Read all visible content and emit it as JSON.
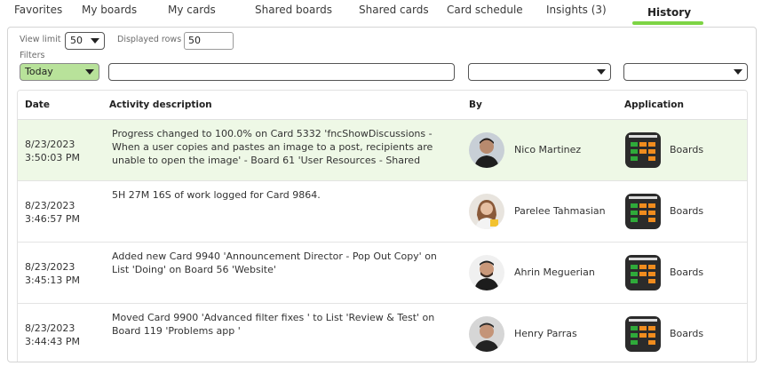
{
  "tabs": [
    {
      "label": "Favorites"
    },
    {
      "label": "My boards"
    },
    {
      "label": "My cards"
    },
    {
      "label": "Shared boards"
    },
    {
      "label": "Shared cards"
    },
    {
      "label": "Card schedule"
    },
    {
      "label": "Insights (3)"
    },
    {
      "label": "History",
      "active": true
    }
  ],
  "controls": {
    "view_limit_label": "View limit",
    "view_limit_value": "50",
    "displayed_rows_label": "Displayed rows",
    "displayed_rows_value": "50",
    "filters_label": "Filters",
    "date_filter_value": "Today",
    "search_value": "",
    "user_filter_value": "",
    "application_filter_value": ""
  },
  "table": {
    "columns": [
      "Date",
      "Activity description",
      "By",
      "Application"
    ],
    "rows": [
      {
        "date": "8/23/2023",
        "time": "3:50:03 PM",
        "description": "Progress changed to 100.0% on Card 5332 'fncShowDiscussions - When a user copies and pastes an image to a post, recipients are unable to open the image' - Board 61 'User Resources - Shared",
        "user": "Nico Martinez",
        "application": "Boards",
        "highlight": true
      },
      {
        "date": "8/23/2023",
        "time": "3:46:57 PM",
        "description": "5H 27M 16S of work logged for Card 9864.",
        "user": "Parelee Tahmasian",
        "application": "Boards"
      },
      {
        "date": "8/23/2023",
        "time": "3:45:13 PM",
        "description": "Added new Card 9940 'Announcement Director - Pop Out Copy' on List 'Doing' on Board 56 'Website'",
        "user": "Ahrin Meguerian",
        "application": "Boards"
      },
      {
        "date": "8/23/2023",
        "time": "3:44:43 PM",
        "description": "Moved Card 9900 'Advanced filter fixes ' to List 'Review & Test' on Board 119 'Problems app  '",
        "user": "Henry Parras",
        "application": "Boards"
      }
    ]
  },
  "colors": {
    "active_tab_underline": "#7dd444",
    "highlight_row": "#eef8e6",
    "today_filter": "#b8e29a"
  },
  "icons": {
    "select_caret": "chevron-down-icon",
    "avatar": "user-avatar",
    "app": "boards-app-icon"
  }
}
